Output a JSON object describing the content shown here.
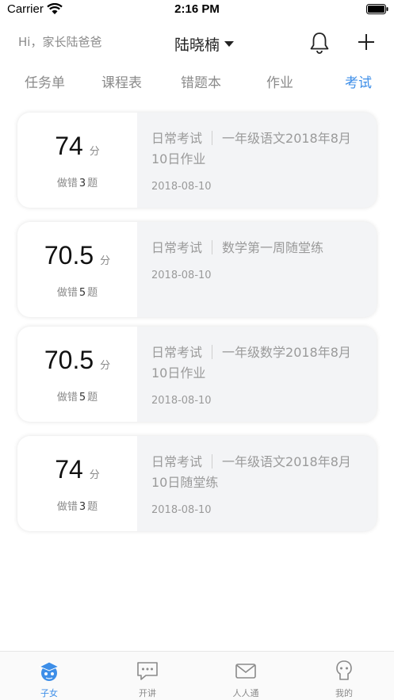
{
  "status_bar": {
    "carrier": "Carrier",
    "time": "2:16 PM"
  },
  "header": {
    "greeting": "Hi，家长陆爸爸",
    "child_name": "陆晓楠"
  },
  "tabs": [
    {
      "label": "任务单",
      "active": false
    },
    {
      "label": "课程表",
      "active": false
    },
    {
      "label": "错题本",
      "active": false
    },
    {
      "label": "作业",
      "active": false
    },
    {
      "label": "考试",
      "active": true
    }
  ],
  "exams": [
    {
      "score": "74",
      "unit": "分",
      "wrong_prefix": "做错",
      "wrong_count": "3",
      "wrong_suffix": "题",
      "type": "日常考试",
      "title_line1": "一年级语文2018年8月",
      "title_line2": "10日作业",
      "date": "2018-08-10"
    },
    {
      "score": "70.5",
      "unit": "分",
      "wrong_prefix": "做错",
      "wrong_count": "5",
      "wrong_suffix": "题",
      "type": "日常考试",
      "title_line1": "数学第一周随堂练",
      "title_line2": "",
      "date": "2018-08-10"
    },
    {
      "score": "70.5",
      "unit": "分",
      "wrong_prefix": "做错",
      "wrong_count": "5",
      "wrong_suffix": "题",
      "type": "日常考试",
      "title_line1": "一年级数学2018年8月",
      "title_line2": "10日作业",
      "date": "2018-08-10"
    },
    {
      "score": "74",
      "unit": "分",
      "wrong_prefix": "做错",
      "wrong_count": "3",
      "wrong_suffix": "题",
      "type": "日常考试",
      "title_line1": "一年级语文2018年8月",
      "title_line2": "10日随堂练",
      "date": "2018-08-10"
    }
  ],
  "bottom_nav": [
    {
      "label": "子女",
      "icon": "graduation-cap-icon",
      "active": true
    },
    {
      "label": "开讲",
      "icon": "chat-bubble-icon",
      "active": false
    },
    {
      "label": "人人通",
      "icon": "envelope-icon",
      "active": false
    },
    {
      "label": "我的",
      "icon": "profile-face-icon",
      "active": false
    }
  ],
  "colors": {
    "accent": "#3d8ee8",
    "muted": "#8a8a8a",
    "card_bg": "#f3f4f6"
  }
}
